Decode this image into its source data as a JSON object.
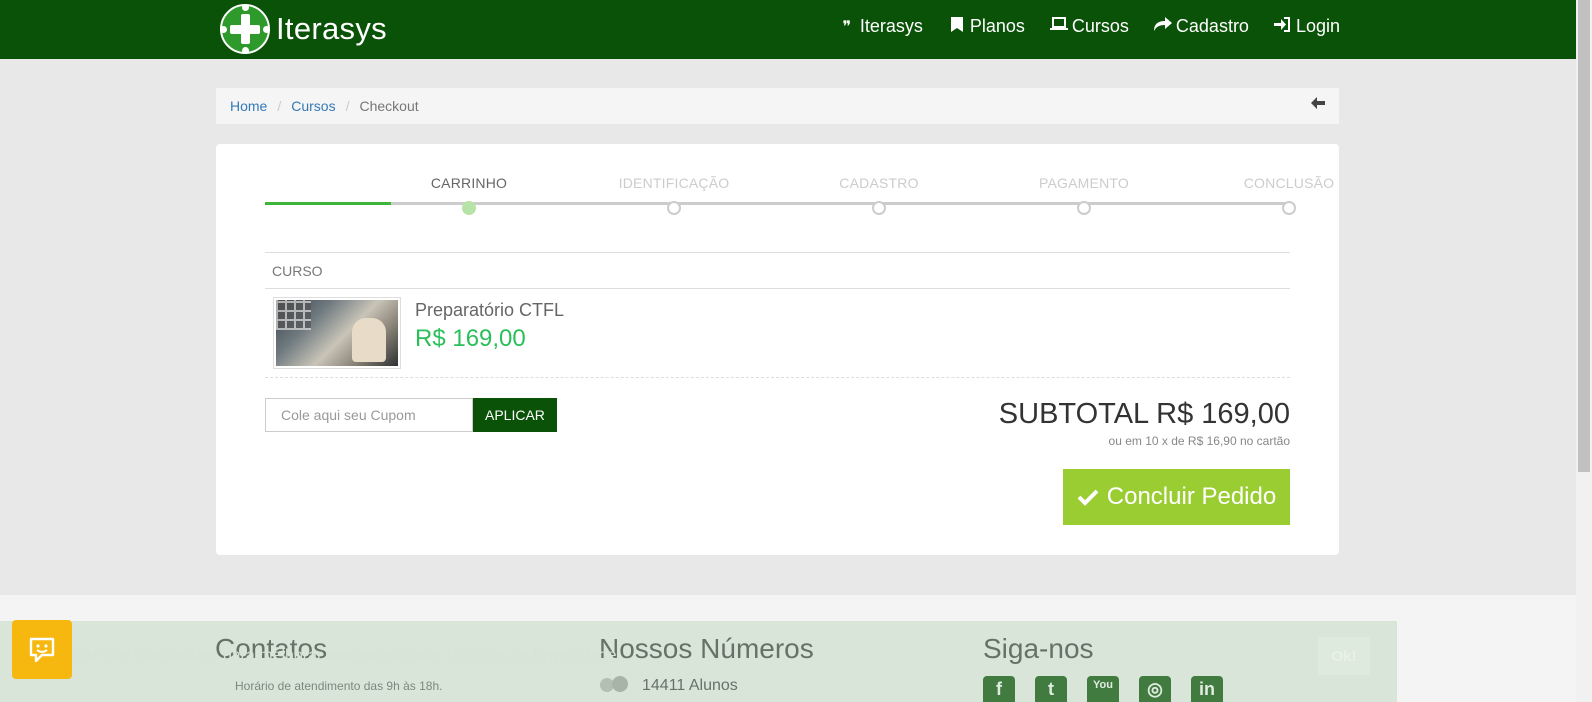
{
  "header": {
    "logo_text": "Iterasys",
    "nav": [
      {
        "label": "Iterasys",
        "icon": "quote-icon"
      },
      {
        "label": "Planos",
        "icon": "bookmark-icon"
      },
      {
        "label": "Cursos",
        "icon": "laptop-icon"
      },
      {
        "label": "Cadastro",
        "icon": "share-icon"
      },
      {
        "label": "Login",
        "icon": "sign-in-icon"
      }
    ],
    "brand_color": "#0a5208"
  },
  "breadcrumb": {
    "items": [
      "Home",
      "Cursos"
    ],
    "current": "Checkout"
  },
  "steps": {
    "items": [
      "CARRINHO",
      "IDENTIFICAÇÃO",
      "CADASTRO",
      "PAGAMENTO",
      "CONCLUSÃO"
    ],
    "active": "CARRINHO"
  },
  "cart": {
    "column_header": "CURSO",
    "item": {
      "name": "Preparatório CTFL",
      "price": "R$ 169,00"
    }
  },
  "coupon": {
    "placeholder": "Cole aqui seu Cupom",
    "apply_label": "APLICAR"
  },
  "summary": {
    "subtotal": "SUBTOTAL R$ 169,00",
    "installments": "ou em 10 x de R$ 16,90 no cartão",
    "conclude_label": "Concluir Pedido"
  },
  "footer": {
    "contacts_heading": "Contatos",
    "contacts_hours": "Horário de atendimento das 9h às 18h.",
    "numbers_heading": "Nossos Números",
    "students": "14411 Alunos",
    "social_heading": "Siga-nos",
    "social": [
      "facebook-icon",
      "twitter-icon",
      "youtube-icon",
      "instagram-icon",
      "linkedin-icon"
    ]
  },
  "cookie": {
    "text": "Este site usa cookies para melhorar sua experiência.",
    "link": "Política de Privacidade",
    "ok": "Ok!"
  },
  "colors": {
    "accent_green": "#9acd32",
    "price_green": "#2bbf5a",
    "chat_yellow": "#f6b70f"
  }
}
